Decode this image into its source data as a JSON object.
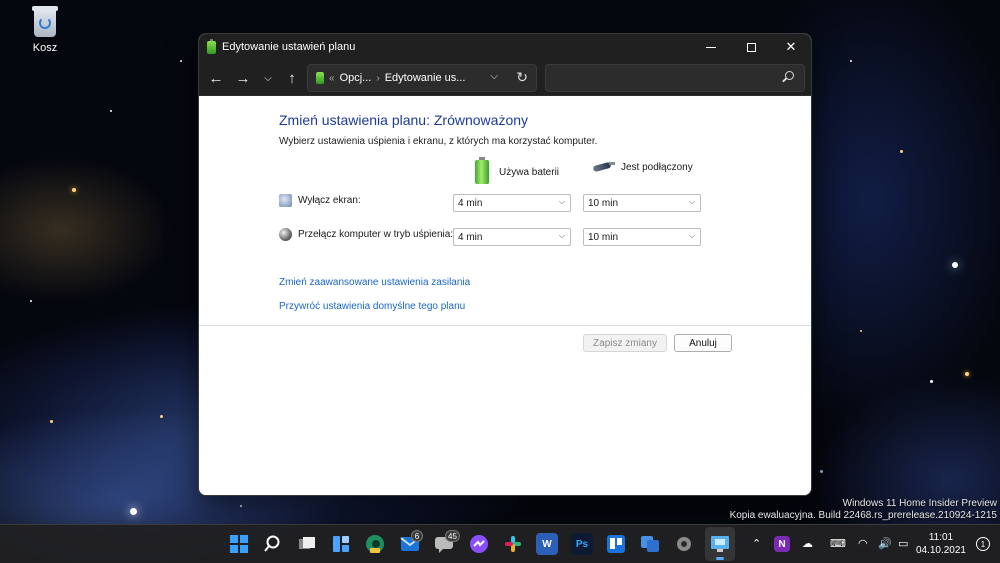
{
  "desktop": {
    "recycle_bin_label": "Kosz"
  },
  "window": {
    "title": "Edytowanie ustawień planu",
    "breadcrumb_parent": "Opcj...",
    "breadcrumb_current": "Edytowanie us...",
    "breadcrumb_overflow": "«",
    "search_placeholder": ""
  },
  "plan": {
    "heading": "Zmień ustawienia planu: Zrównoważony",
    "description": "Wybierz ustawienia uśpienia i ekranu, z których ma korzystać komputer.",
    "col_battery": "Używa baterii",
    "col_plugged": "Jest podłączony",
    "rows": [
      {
        "label": "Wyłącz ekran:",
        "battery": "4 min",
        "plugged": "10 min"
      },
      {
        "label": "Przełącz komputer w tryb uśpienia:",
        "battery": "4 min",
        "plugged": "10 min"
      }
    ],
    "link_advanced": "Zmień zaawansowane ustawienia zasilania",
    "link_restore": "Przywróć ustawienia domyślne tego planu",
    "save_label": "Zapisz zmiany",
    "cancel_label": "Anuluj"
  },
  "watermark": {
    "line1": "Windows 11 Home Insider Preview",
    "line2": "Kopia ewaluacyjna. Build 22468.rs_prerelease.210924-1215"
  },
  "taskbar": {
    "badge_mail": "6",
    "badge_messages": "45",
    "app_ps": "Ps",
    "app_word": "W",
    "app_onenote": "N",
    "time": "11:01",
    "date": "04.10.2021",
    "notification_count": "1"
  },
  "colors": {
    "accent": "#1e3a9c",
    "link": "#1a66c9",
    "titlebar": "#202020"
  }
}
